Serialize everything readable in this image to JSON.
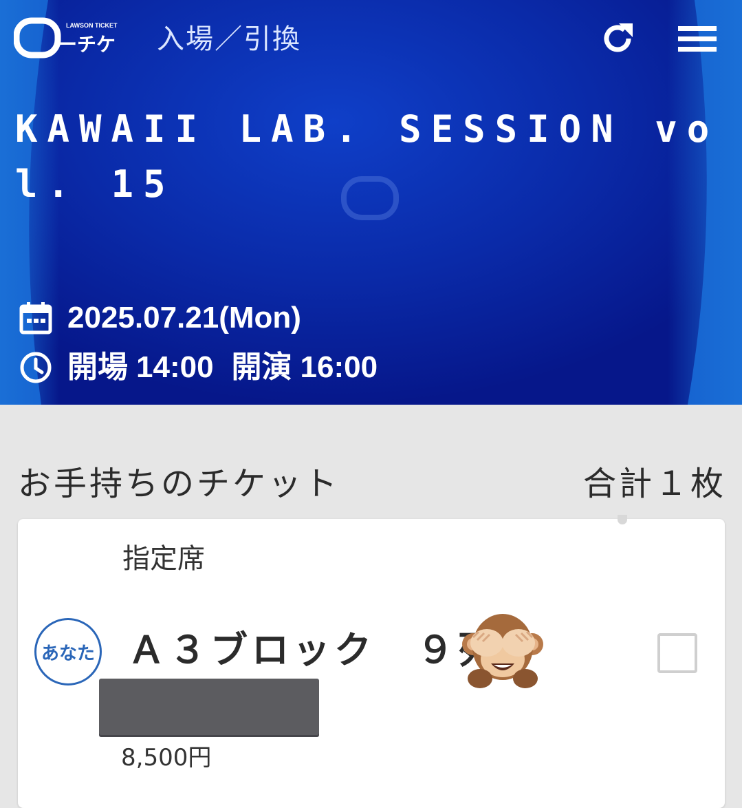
{
  "header": {
    "logo_brand": "LAWSON TICKET",
    "logo_text": "ーチケ",
    "title": "入場／引換",
    "refresh_icon": "refresh-icon",
    "menu_icon": "hamburger-menu-icon"
  },
  "event": {
    "title": "KAWAII LAB. SESSION vol. 15",
    "date": "2025.07.21(Mon)",
    "open_label": "開場",
    "open_time": "14:00",
    "start_label": "開演",
    "start_time": "16:00",
    "date_icon": "calendar-icon",
    "time_icon": "clock-icon"
  },
  "tickets": {
    "heading": "お手持ちのチケット",
    "total": "合計１枚",
    "items": [
      {
        "seat_type": "指定席",
        "holder_badge": "あなた",
        "seat": "Ａ３ブロック　９列",
        "price": "8,500円",
        "selected": false
      }
    ]
  },
  "colors": {
    "hero_blue": "#0f4fb8",
    "hero_deep": "#061a8c",
    "badge_blue": "#2a66b8",
    "page_bg": "#e6e6e6"
  }
}
